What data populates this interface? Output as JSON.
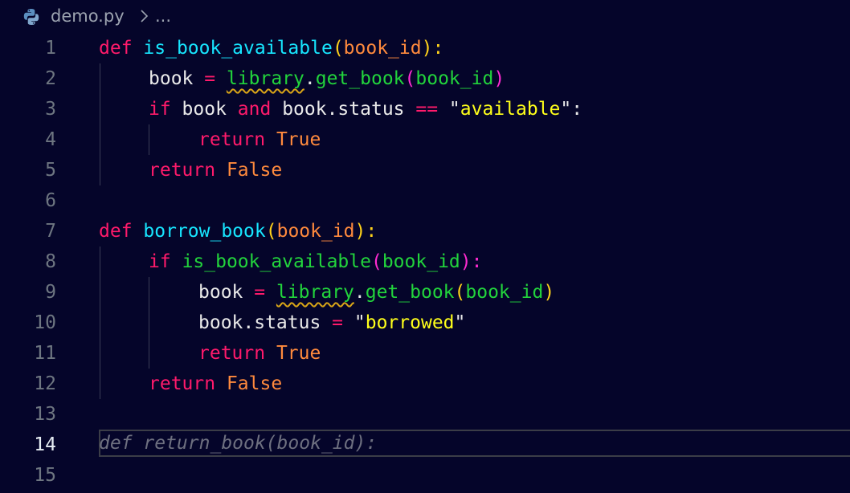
{
  "breadcrumb": {
    "file_name": "demo.py",
    "more": "...",
    "icon": "python-icon"
  },
  "colors": {
    "background": "#05052a",
    "keyword": "#ff1a6b",
    "function": "#17e6ff",
    "parameter": "#ff8a3d",
    "string": "#ffff1a",
    "call": "#22d43c",
    "ghost_suggestion": "#6e7080"
  },
  "editor": {
    "active_line": 14,
    "line_numbers": [
      "1",
      "2",
      "3",
      "4",
      "5",
      "6",
      "7",
      "8",
      "9",
      "10",
      "11",
      "12",
      "13",
      "14",
      "15"
    ],
    "tokens": {
      "l1": [
        "def",
        " ",
        "is_book_available",
        "(",
        "book_id",
        "):"
      ],
      "l2": [
        "book",
        " = ",
        "library",
        ".",
        "get_book",
        "(",
        "book_id",
        ")"
      ],
      "l3": [
        "if",
        " book ",
        "and",
        " book.status ",
        "==",
        " \"",
        "available",
        "\":"
      ],
      "l4": [
        "return",
        " ",
        "True"
      ],
      "l5": [
        "return",
        " ",
        "False"
      ],
      "l7": [
        "def",
        " ",
        "borrow_book",
        "(",
        "book_id",
        "):"
      ],
      "l8": [
        "if",
        " ",
        "is_book_available",
        "(",
        "book_id",
        "):"
      ],
      "l9": [
        "book",
        " = ",
        "library",
        ".",
        "get_book",
        "(",
        "book_id",
        ")"
      ],
      "l10": [
        "book.status",
        " = ",
        "\"",
        "borrowed",
        "\""
      ],
      "l11": [
        "return",
        " ",
        "True"
      ],
      "l12": [
        "return",
        " ",
        "False"
      ],
      "l14": "def return_book(book_id):"
    }
  }
}
